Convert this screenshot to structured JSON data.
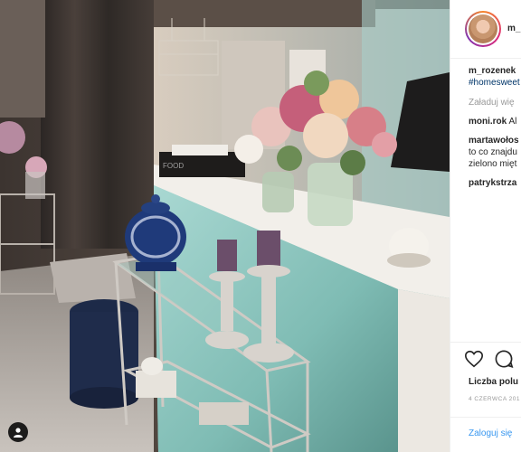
{
  "post": {
    "username": "m_rozenek",
    "header_username": "m_",
    "caption_hashtag": "#homesweet",
    "load_more": "Załaduj wię",
    "comments": [
      {
        "user": "moni.rok",
        "text": "Al"
      },
      {
        "user": "martawołos",
        "text": "",
        "continuation": [
          "to co znajdu",
          "zielono mięt"
        ]
      },
      {
        "user": "patrykstrza",
        "text": ""
      }
    ],
    "likes_label": "Liczba polu",
    "date": "4 CZERWCA 201",
    "login_link": "Zaloguj się"
  },
  "icons": {
    "heart": "heart-icon",
    "comment": "comment-icon",
    "tag": "tagged-user-icon"
  },
  "colors": {
    "link": "#003569",
    "login": "#3897f0",
    "text": "#262626",
    "muted": "#999999"
  }
}
